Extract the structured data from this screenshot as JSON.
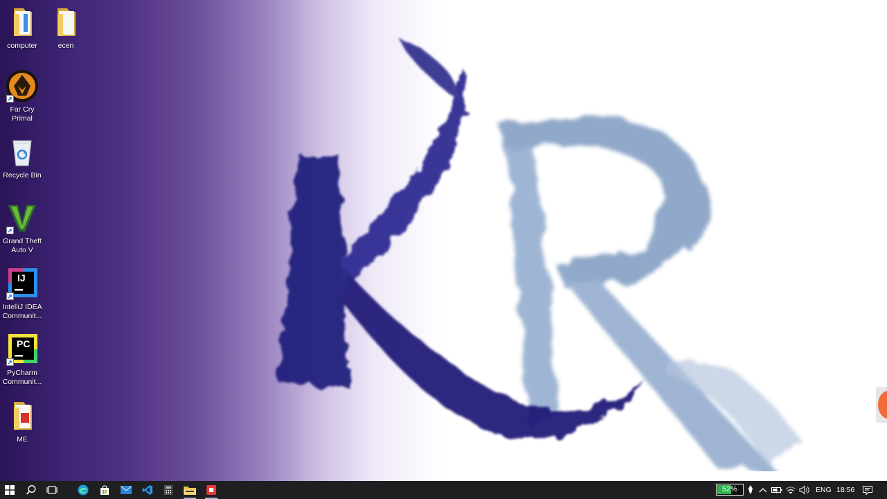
{
  "desktop": {
    "icons": [
      {
        "label": "computer",
        "type": "folder"
      },
      {
        "label": "ecen",
        "type": "folder"
      },
      {
        "label": "Far Cry Primal",
        "type": "game"
      },
      {
        "label": "Recycle Bin",
        "type": "recycle"
      },
      {
        "label": "Grand Theft Auto V",
        "type": "gta"
      },
      {
        "label": "IntelliJ IDEA Communit...",
        "type": "intellij",
        "logo_text": "IJ"
      },
      {
        "label": "PyCharm Communit...",
        "type": "pycharm",
        "logo_text": "PC"
      },
      {
        "label": "ME",
        "type": "pdf-folder"
      }
    ],
    "wallpaper": {
      "letters": [
        "K",
        "R"
      ],
      "colors": {
        "k": "#1c1a7a",
        "r": "#6c8cb8"
      }
    }
  },
  "taskbar": {
    "pinned": [
      "windows-start-icon",
      "search-icon",
      "task-view-icon",
      "edge-icon",
      "store-icon",
      "mail-icon",
      "vscode-icon",
      "calculator-icon",
      "file-explorer-icon",
      "screen-recorder-icon"
    ],
    "battery_percent": 52,
    "battery_label": "52%",
    "language": "ENG",
    "time": "18:56"
  },
  "colors": {
    "taskbar": "#1f1f22",
    "battery": "#2bb24c",
    "accent": "#9fb7d9"
  }
}
